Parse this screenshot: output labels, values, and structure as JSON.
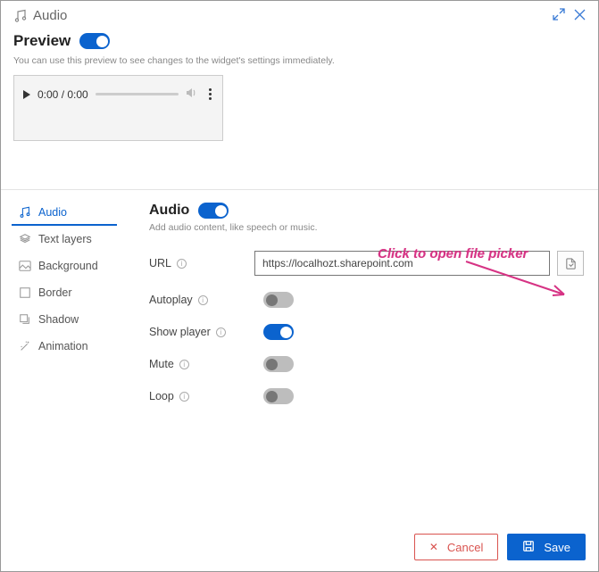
{
  "header": {
    "title": "Audio"
  },
  "preview": {
    "heading": "Preview",
    "hint": "You can use this preview to see changes to the widget's settings immediately.",
    "time": "0:00 / 0:00"
  },
  "tabs": {
    "audio": "Audio",
    "text_layers": "Text layers",
    "background": "Background",
    "border": "Border",
    "shadow": "Shadow",
    "animation": "Animation"
  },
  "panel": {
    "title": "Audio",
    "subtitle": "Add audio content, like speech or music.",
    "fields": {
      "url_label": "URL",
      "url_value": "https://localhozt.sharepoint.com",
      "autoplay_label": "Autoplay",
      "showplayer_label": "Show player",
      "mute_label": "Mute",
      "loop_label": "Loop"
    }
  },
  "annotation": {
    "text": "Click to open file picker"
  },
  "footer": {
    "cancel": "Cancel",
    "save": "Save"
  }
}
